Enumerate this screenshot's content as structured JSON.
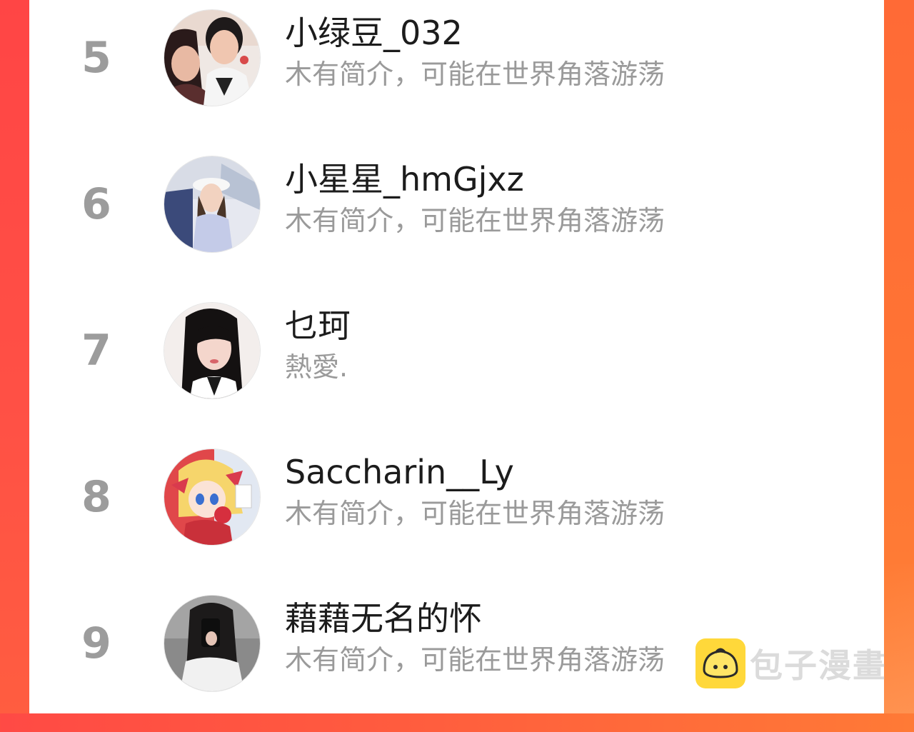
{
  "users": [
    {
      "rank": "5",
      "name": "小绿豆_032",
      "bio": "木有简介，可能在世界角落游荡"
    },
    {
      "rank": "6",
      "name": "小星星_hmGjxz",
      "bio": "木有简介，可能在世界角落游荡"
    },
    {
      "rank": "7",
      "name": "乜珂",
      "bio": "熱愛."
    },
    {
      "rank": "8",
      "name": "Saccharin__Ly",
      "bio": "木有简介，可能在世界角落游荡"
    },
    {
      "rank": "9",
      "name": "藉藉无名的怀",
      "bio": "木有简介，可能在世界角落游荡"
    }
  ],
  "watermark": {
    "text": "包子漫畫",
    "logo_icon": "bun-logo-icon"
  },
  "colors": {
    "background_gradient_left": "#ff4a45",
    "background_gradient_right": "#ff7a36",
    "rank_gray": "#9c9c9c",
    "name_text": "#1c1c1c",
    "bio_text": "#9a9a9a",
    "watermark_yellow": "#ffd83a"
  }
}
